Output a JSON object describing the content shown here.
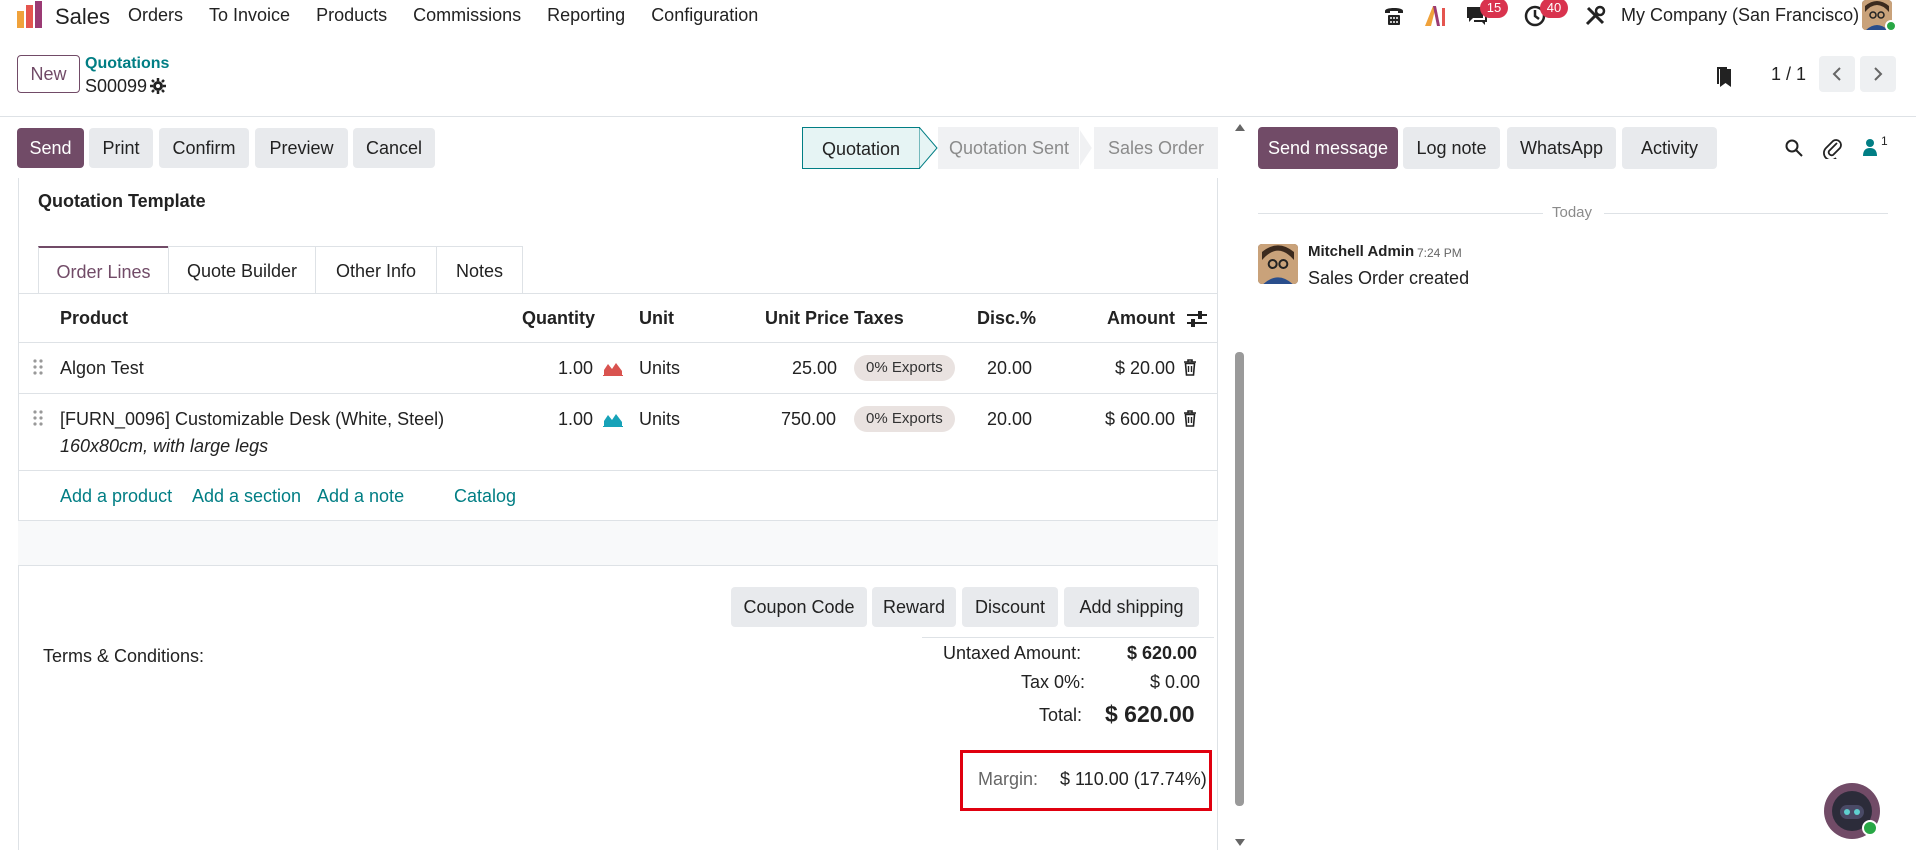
{
  "app": {
    "name": "Sales"
  },
  "menu": [
    "Orders",
    "To Invoice",
    "Products",
    "Commissions",
    "Reporting",
    "Configuration"
  ],
  "systray": {
    "messages_count": "15",
    "activities_count": "40",
    "company": "My Company (San Francisco)"
  },
  "control": {
    "new_label": "New",
    "breadcrumb_parent": "Quotations",
    "record_name": "S00099",
    "pager": "1 / 1"
  },
  "actions": [
    "Send",
    "Print",
    "Confirm",
    "Preview",
    "Cancel"
  ],
  "statusbar": [
    "Quotation",
    "Quotation Sent",
    "Sales Order"
  ],
  "form": {
    "quotation_template_label": "Quotation Template",
    "tabs": [
      "Order Lines",
      "Quote Builder",
      "Other Info",
      "Notes"
    ],
    "columns": [
      "Product",
      "Quantity",
      "Unit",
      "Unit Price",
      "Taxes",
      "Disc.%",
      "Amount"
    ],
    "lines": [
      {
        "product": "Algon Test",
        "description": "",
        "quantity": "1.00",
        "unit": "Units",
        "unit_price": "25.00",
        "tax": "0% Exports",
        "discount": "20.00",
        "amount": "$ 20.00",
        "forecast_color": "#d9534f"
      },
      {
        "product": "[FURN_0096] Customizable Desk (White, Steel)",
        "description": "160x80cm, with large legs",
        "quantity": "1.00",
        "unit": "Units",
        "unit_price": "750.00",
        "tax": "0% Exports",
        "discount": "20.00",
        "amount": "$ 600.00",
        "forecast_color": "#17a2b8"
      }
    ],
    "add_links": [
      "Add a product",
      "Add a section",
      "Add a note",
      "Catalog"
    ],
    "promo_buttons": [
      "Coupon Code",
      "Reward",
      "Discount",
      "Add shipping"
    ],
    "terms_label": "Terms & Conditions:",
    "totals": {
      "untaxed_label": "Untaxed Amount:",
      "untaxed_value": "$ 620.00",
      "tax_label": "Tax 0%:",
      "tax_value": "$ 0.00",
      "total_label": "Total:",
      "total_value": "$ 620.00"
    },
    "margin": {
      "label": "Margin:",
      "value": "$ 110.00 (17.74%)"
    }
  },
  "chatter": {
    "buttons": [
      "Send message",
      "Log note",
      "WhatsApp",
      "Activity"
    ],
    "followers_count": "1",
    "date_separator": "Today",
    "message": {
      "author": "Mitchell Admin",
      "time": "7:24 PM",
      "body": "Sales Order created"
    }
  },
  "colors": {
    "brand": "#714b67",
    "accent": "#017e84",
    "highlight": "#e0000f"
  }
}
